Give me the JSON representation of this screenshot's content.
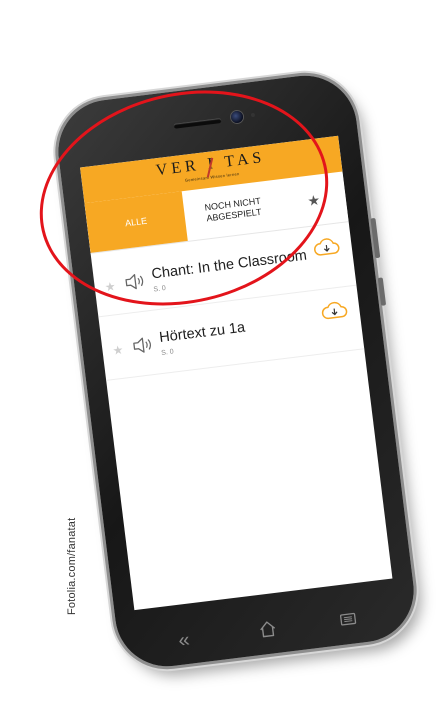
{
  "watermark": "Fotolia.com/fanatat",
  "app": {
    "brand_title": "VER I TAS",
    "brand_subtitle": "Gemeinsam Wissen lernen"
  },
  "tabs": [
    {
      "label": "ALLE",
      "active": true
    },
    {
      "label": "NOCH NICHT ABGESPIELT",
      "active": false
    },
    {
      "icon": "star-icon",
      "active": false
    }
  ],
  "items": [
    {
      "title": "Chant: In the Classroom",
      "page": "S. 0",
      "icon": "speaker-icon",
      "action_icon": "cloud-download-icon",
      "favorite": false
    },
    {
      "title": "Hörtext zu 1a",
      "page": "S. 0",
      "icon": "speaker-icon",
      "action_icon": "cloud-download-icon",
      "favorite": false
    }
  ],
  "navbar": {
    "back_icon": "double-chevron-left-icon",
    "home_icon": "home-icon",
    "menu_icon": "menu-icon"
  },
  "colors": {
    "accent": "#f7a823",
    "highlight": "#e3141b",
    "download": "#f7a823"
  }
}
